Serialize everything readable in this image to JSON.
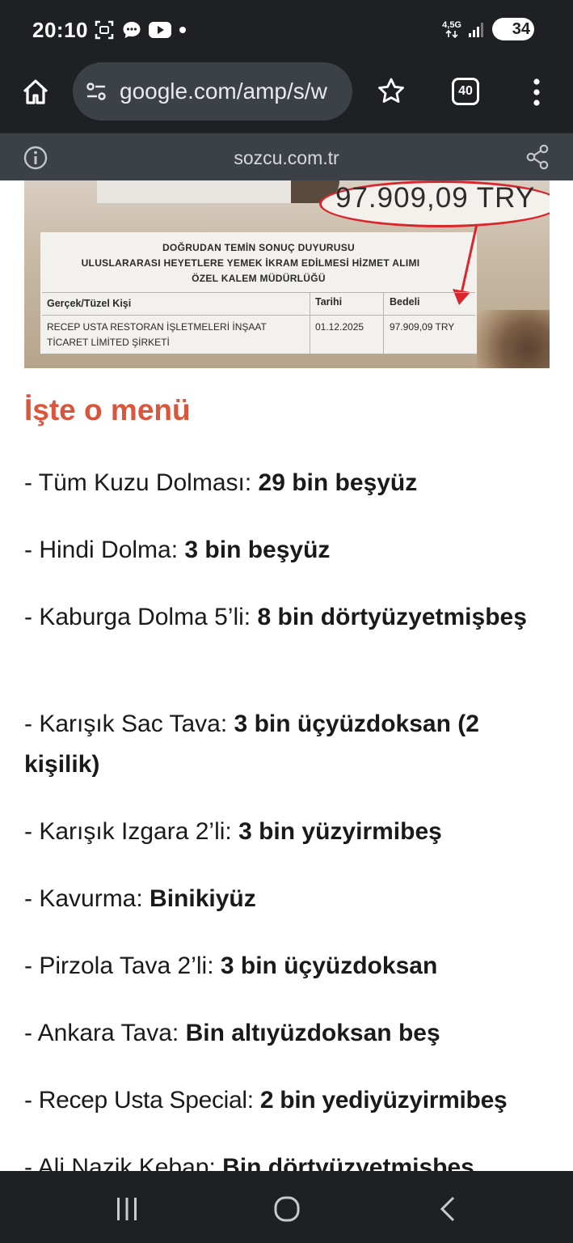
{
  "status_bar": {
    "time": "20:10",
    "network": "4,5G",
    "battery": "34",
    "icons": [
      "screenshot-icon",
      "chat-icon",
      "youtube-icon",
      "notification-dot-icon",
      "signal-icon",
      "battery-icon"
    ]
  },
  "browser": {
    "url": "google.com/amp/s/w",
    "tab_count": "40",
    "icons": [
      "home-icon",
      "site-settings-icon",
      "star-icon",
      "tabs-icon",
      "more-vert-icon"
    ]
  },
  "amp_header": {
    "domain": "sozcu.com.tr",
    "icons": [
      "info-icon",
      "share-icon"
    ]
  },
  "article_image": {
    "price_callout": "97.909,09 TRY",
    "doc_title_1": "DOĞRUDAN TEMİN SONUÇ DUYURUSU",
    "doc_title_2": "ULUSLARARASI HEYETLERE YEMEK İKRAM EDİLMESİ HİZMET ALIMI",
    "doc_title_3": "ÖZEL KALEM MÜDÜRLÜĞÜ",
    "col_person": "Gerçek/Tüzel Kişi",
    "col_date": "Tarihi",
    "col_amount": "Bedeli",
    "row_person_1": "RECEP USTA RESTORAN İŞLETMELERİ İNŞAAT",
    "row_person_2": "TİCARET LİMİTED ŞİRKETİ",
    "row_date": "01.12.2025",
    "row_amount": "97.909,09 TRY"
  },
  "article": {
    "heading": "İşte o menü",
    "items": [
      {
        "label": "- Tüm Kuzu Dolması: ",
        "price": "29 bin beşyüz"
      },
      {
        "label": "- Hindi Dolma: ",
        "price": "3 bin beşyüz"
      },
      {
        "label": "- Kaburga Dolma 5’li: ",
        "price": "8 bin dörtyüzyetmişbeş"
      },
      {
        "label": "- Karışık Sac Tava: ",
        "price": "3 bin üçyüzdoksan (2 kişilik)"
      },
      {
        "label": "- Karışık Izgara 2’li: ",
        "price": "3 bin yüzyirmibeş"
      },
      {
        "label": "- Kavurma: ",
        "price": "Binikiyüz"
      },
      {
        "label": "- Pirzola Tava 2’li: ",
        "price": "3 bin üçyüzdoksan"
      },
      {
        "label": "- Ankara Tava: ",
        "price": "Bin altıyüzdoksan beş"
      },
      {
        "label": "- Recep Usta Special: ",
        "price": "2 bin yediyüzyirmibeş"
      },
      {
        "label": "- Ali Nazik Kebap: ",
        "price": "Bin dörtyüzyetmişbeş"
      }
    ]
  },
  "nav_bar": {
    "icons": [
      "recent-apps-icon",
      "home-nav-icon",
      "back-icon"
    ]
  },
  "colors": {
    "heading_accent": "#d9553b",
    "price_oval": "#d9262d",
    "chrome_dark": "#1f2024",
    "amp_bar": "#3c4047"
  }
}
